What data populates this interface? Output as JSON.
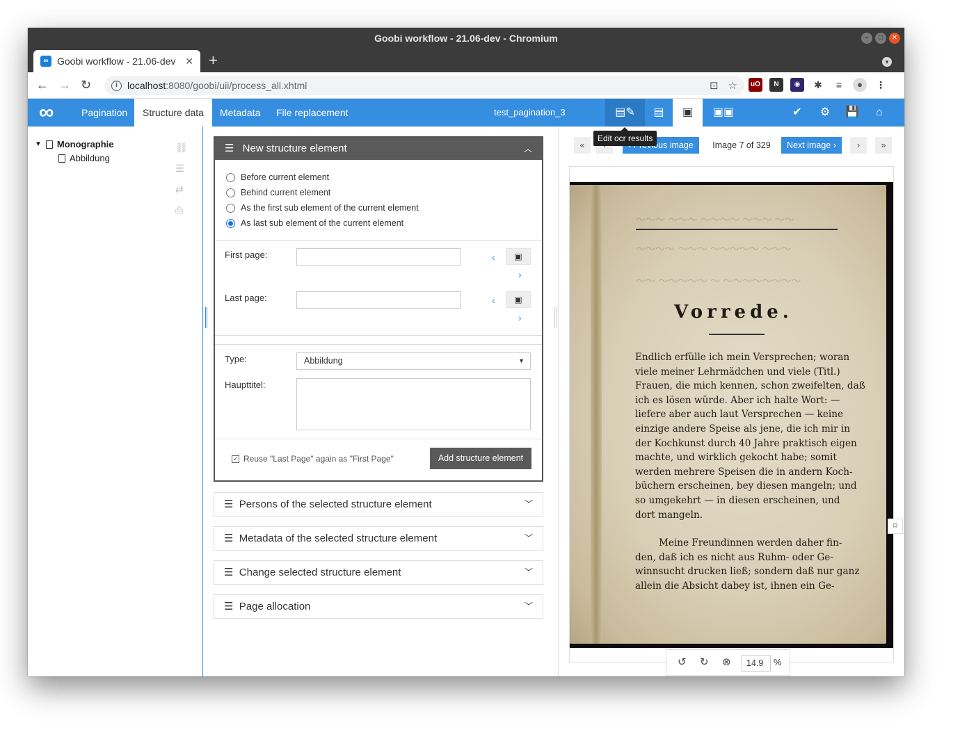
{
  "os": {
    "window_title": "Goobi workflow - 21.06-dev - Chromium"
  },
  "browser": {
    "tab_title": "Goobi workflow - 21.06-dev",
    "url_host": "localhost",
    "url_path": ":8080/goobi/uii/process_all.xhtml"
  },
  "app": {
    "nav_tabs": [
      "Pagination",
      "Structure data",
      "Metadata",
      "File replacement"
    ],
    "process_title": "test_pagination_3",
    "tooltip": "Edit ocr results",
    "colors": {
      "primary": "#368ee0",
      "dark_header": "#5a5a5a"
    }
  },
  "tree": {
    "root": "Monographie",
    "child": "Abbildung"
  },
  "new_structure": {
    "title": "New structure element",
    "options": [
      {
        "label": "Before current element",
        "checked": false
      },
      {
        "label": "Behind current element",
        "checked": false
      },
      {
        "label": "As the first sub element of the current element",
        "checked": false
      },
      {
        "label": "As last sub element of the current element",
        "checked": true
      }
    ],
    "first_page_label": "First page:",
    "first_page_value": "",
    "last_page_label": "Last page:",
    "last_page_value": "",
    "type_label": "Type:",
    "type_value": "Abbildung",
    "haupttitel_label": "Haupttitel:",
    "haupttitel_value": "",
    "reuse_label": "Reuse \"Last Page\" again as \"First Page\"",
    "add_button": "Add structure element"
  },
  "collapsed_boxes": [
    "Persons of the selected structure element",
    "Metadata of the selected structure element",
    "Change selected structure element",
    "Page allocation"
  ],
  "viewer": {
    "prev_label": "Previous image",
    "next_label": "Next image",
    "counter": "Image 7 of 329",
    "zoom": "14.9",
    "zoom_unit": "%",
    "page_heading": "Vorrede.",
    "page_lines_1": [
      "Endlich erfülle ich mein Versprechen; woran",
      "viele meiner Lehrmädchen und viele (Titl.)",
      "Frauen, die mich kennen, schon zweifelten, daß",
      "ich es lösen würde. Aber ich halte Wort: —",
      "liefere aber auch laut Versprechen — keine",
      "einzige andere Speise als jene, die ich mir in",
      "der Kochkunst durch 40 Jahre praktisch eigen",
      "machte, und wirklich gekocht habe; somit",
      "werden mehrere Speisen die in andern Koch-",
      "büchern erscheinen, bey diesen mangeln; und",
      "so umgekehrt — in diesen erscheinen, und",
      "dort mangeln."
    ],
    "page_lines_2": [
      "Meine Freundinnen werden daher fin-",
      "den, daß ich es nicht aus Ruhm- oder Ge-",
      "winnsucht drucken ließ; sondern daß nur ganz",
      "allein die Absicht dabey ist, ihnen ein Ge-"
    ]
  }
}
